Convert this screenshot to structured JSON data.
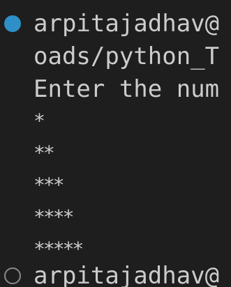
{
  "terminal": {
    "prompt_line_1": "arpitajadhav@",
    "path_line": "oads/python_T",
    "input_prompt": "Enter the num",
    "output_rows": [
      "*",
      "**",
      "***",
      "****",
      "*****"
    ],
    "prompt_line_2": "arpitajadhav@",
    "colors": {
      "background": "#1e1e1e",
      "text": "#cccccc",
      "success_dot": "#2f8fc7",
      "empty_dot": "#8a8a8a"
    },
    "icons": [
      "command-success-dot-icon",
      "command-empty-dot-icon"
    ]
  }
}
